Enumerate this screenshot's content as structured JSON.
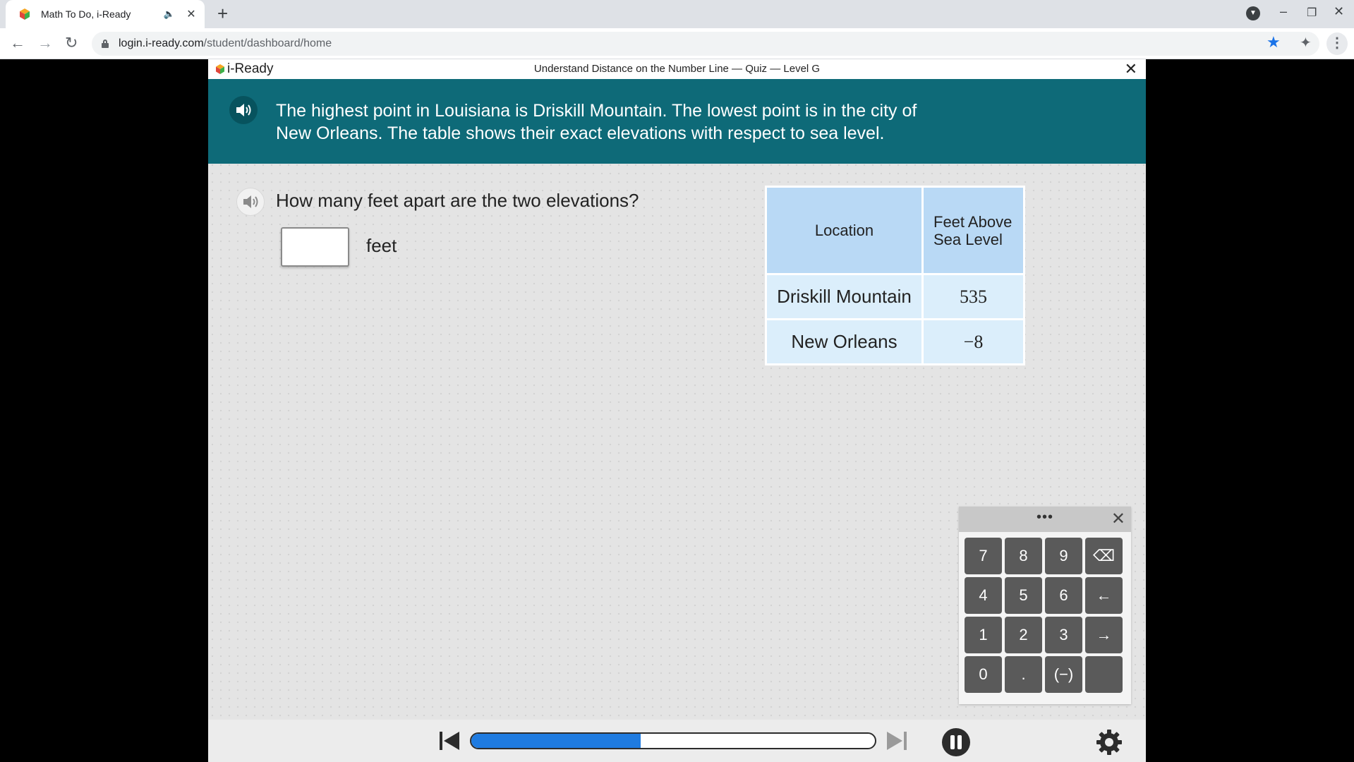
{
  "browser": {
    "tab_title": "Math To Do, i-Ready",
    "url_host": "login.i-ready.com",
    "url_path": "/student/dashboard/home"
  },
  "app": {
    "logo_text": "i-Ready",
    "lesson_title": "Understand Distance on the Number Line — Quiz — Level G",
    "close_label": "✕"
  },
  "banner": {
    "line1": "The highest point in Louisiana is Driskill Mountain. The lowest point is in the city of",
    "line2": "New Orleans. The table shows their exact elevations with respect to sea level."
  },
  "question": {
    "prompt": "How many feet apart are the two elevations?",
    "answer_value": "",
    "unit": "feet"
  },
  "table": {
    "headers": [
      "Location",
      "Feet Above",
      "Sea Level"
    ],
    "rows": [
      {
        "location": "Driskill Mountain",
        "feet": "535"
      },
      {
        "location": "New Orleans",
        "feet": "−8"
      }
    ]
  },
  "keypad": {
    "dots": "•••",
    "close": "✕",
    "keys": [
      "7",
      "8",
      "9",
      "⌫",
      "4",
      "5",
      "6",
      "←",
      "1",
      "2",
      "3",
      "→",
      "0",
      ".",
      "(−)",
      ""
    ]
  },
  "progress": {
    "fraction": 0.42,
    "accent": "#1f7be0"
  },
  "colors": {
    "banner": "#0e6a78",
    "table_header": "#b9d9f5",
    "table_cell": "#dbeefb"
  }
}
